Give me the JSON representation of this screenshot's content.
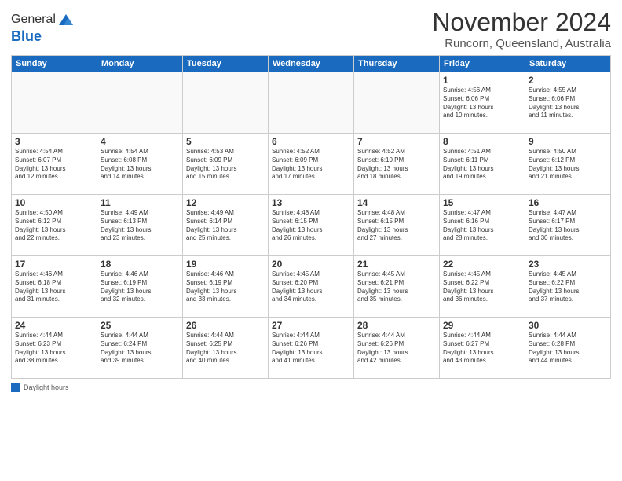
{
  "logo": {
    "general": "General",
    "blue": "Blue"
  },
  "title": "November 2024",
  "location": "Runcorn, Queensland, Australia",
  "days": [
    "Sunday",
    "Monday",
    "Tuesday",
    "Wednesday",
    "Thursday",
    "Friday",
    "Saturday"
  ],
  "weeks": [
    [
      {
        "num": "",
        "info": ""
      },
      {
        "num": "",
        "info": ""
      },
      {
        "num": "",
        "info": ""
      },
      {
        "num": "",
        "info": ""
      },
      {
        "num": "",
        "info": ""
      },
      {
        "num": "1",
        "info": "Sunrise: 4:56 AM\nSunset: 6:06 PM\nDaylight: 13 hours\nand 10 minutes."
      },
      {
        "num": "2",
        "info": "Sunrise: 4:55 AM\nSunset: 6:06 PM\nDaylight: 13 hours\nand 11 minutes."
      }
    ],
    [
      {
        "num": "3",
        "info": "Sunrise: 4:54 AM\nSunset: 6:07 PM\nDaylight: 13 hours\nand 12 minutes."
      },
      {
        "num": "4",
        "info": "Sunrise: 4:54 AM\nSunset: 6:08 PM\nDaylight: 13 hours\nand 14 minutes."
      },
      {
        "num": "5",
        "info": "Sunrise: 4:53 AM\nSunset: 6:09 PM\nDaylight: 13 hours\nand 15 minutes."
      },
      {
        "num": "6",
        "info": "Sunrise: 4:52 AM\nSunset: 6:09 PM\nDaylight: 13 hours\nand 17 minutes."
      },
      {
        "num": "7",
        "info": "Sunrise: 4:52 AM\nSunset: 6:10 PM\nDaylight: 13 hours\nand 18 minutes."
      },
      {
        "num": "8",
        "info": "Sunrise: 4:51 AM\nSunset: 6:11 PM\nDaylight: 13 hours\nand 19 minutes."
      },
      {
        "num": "9",
        "info": "Sunrise: 4:50 AM\nSunset: 6:12 PM\nDaylight: 13 hours\nand 21 minutes."
      }
    ],
    [
      {
        "num": "10",
        "info": "Sunrise: 4:50 AM\nSunset: 6:12 PM\nDaylight: 13 hours\nand 22 minutes."
      },
      {
        "num": "11",
        "info": "Sunrise: 4:49 AM\nSunset: 6:13 PM\nDaylight: 13 hours\nand 23 minutes."
      },
      {
        "num": "12",
        "info": "Sunrise: 4:49 AM\nSunset: 6:14 PM\nDaylight: 13 hours\nand 25 minutes."
      },
      {
        "num": "13",
        "info": "Sunrise: 4:48 AM\nSunset: 6:15 PM\nDaylight: 13 hours\nand 26 minutes."
      },
      {
        "num": "14",
        "info": "Sunrise: 4:48 AM\nSunset: 6:15 PM\nDaylight: 13 hours\nand 27 minutes."
      },
      {
        "num": "15",
        "info": "Sunrise: 4:47 AM\nSunset: 6:16 PM\nDaylight: 13 hours\nand 28 minutes."
      },
      {
        "num": "16",
        "info": "Sunrise: 4:47 AM\nSunset: 6:17 PM\nDaylight: 13 hours\nand 30 minutes."
      }
    ],
    [
      {
        "num": "17",
        "info": "Sunrise: 4:46 AM\nSunset: 6:18 PM\nDaylight: 13 hours\nand 31 minutes."
      },
      {
        "num": "18",
        "info": "Sunrise: 4:46 AM\nSunset: 6:19 PM\nDaylight: 13 hours\nand 32 minutes."
      },
      {
        "num": "19",
        "info": "Sunrise: 4:46 AM\nSunset: 6:19 PM\nDaylight: 13 hours\nand 33 minutes."
      },
      {
        "num": "20",
        "info": "Sunrise: 4:45 AM\nSunset: 6:20 PM\nDaylight: 13 hours\nand 34 minutes."
      },
      {
        "num": "21",
        "info": "Sunrise: 4:45 AM\nSunset: 6:21 PM\nDaylight: 13 hours\nand 35 minutes."
      },
      {
        "num": "22",
        "info": "Sunrise: 4:45 AM\nSunset: 6:22 PM\nDaylight: 13 hours\nand 36 minutes."
      },
      {
        "num": "23",
        "info": "Sunrise: 4:45 AM\nSunset: 6:22 PM\nDaylight: 13 hours\nand 37 minutes."
      }
    ],
    [
      {
        "num": "24",
        "info": "Sunrise: 4:44 AM\nSunset: 6:23 PM\nDaylight: 13 hours\nand 38 minutes."
      },
      {
        "num": "25",
        "info": "Sunrise: 4:44 AM\nSunset: 6:24 PM\nDaylight: 13 hours\nand 39 minutes."
      },
      {
        "num": "26",
        "info": "Sunrise: 4:44 AM\nSunset: 6:25 PM\nDaylight: 13 hours\nand 40 minutes."
      },
      {
        "num": "27",
        "info": "Sunrise: 4:44 AM\nSunset: 6:26 PM\nDaylight: 13 hours\nand 41 minutes."
      },
      {
        "num": "28",
        "info": "Sunrise: 4:44 AM\nSunset: 6:26 PM\nDaylight: 13 hours\nand 42 minutes."
      },
      {
        "num": "29",
        "info": "Sunrise: 4:44 AM\nSunset: 6:27 PM\nDaylight: 13 hours\nand 43 minutes."
      },
      {
        "num": "30",
        "info": "Sunrise: 4:44 AM\nSunset: 6:28 PM\nDaylight: 13 hours\nand 44 minutes."
      }
    ]
  ],
  "footer": {
    "legend_label": "Daylight hours"
  }
}
